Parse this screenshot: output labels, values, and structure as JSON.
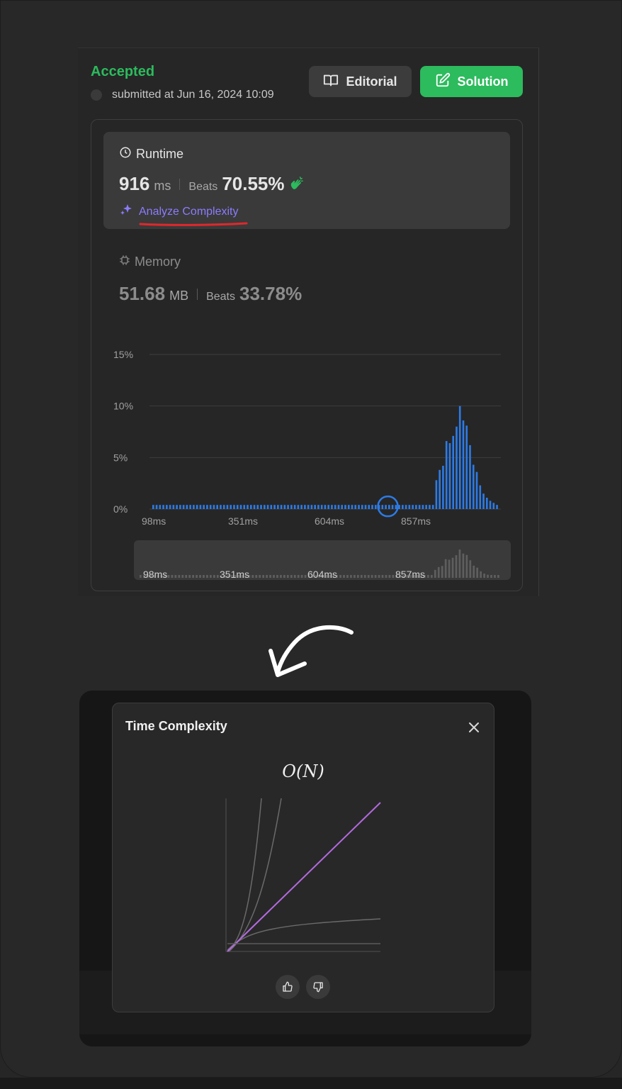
{
  "submission": {
    "status": "Accepted",
    "submitted_text": "submitted at Jun 16, 2024 10:09",
    "editorial_label": "Editorial",
    "solution_label": "Solution",
    "status_color": "#2cbb5d"
  },
  "runtime": {
    "heading": "Runtime",
    "value": "916",
    "unit": "ms",
    "beats_label": "Beats",
    "beats_value": "70.55%",
    "analyze_label": "Analyze Complexity"
  },
  "memory": {
    "heading": "Memory",
    "value": "51.68",
    "unit": "MB",
    "beats_label": "Beats",
    "beats_value": "33.78%"
  },
  "chart_data": {
    "type": "bar",
    "ylabels": [
      "15%",
      "10%",
      "5%",
      "0%"
    ],
    "ylim": [
      0,
      15
    ],
    "xticks": [
      "98ms",
      "351ms",
      "604ms",
      "857ms"
    ],
    "highlight_index": 69,
    "values": [
      0.4,
      0.4,
      0.4,
      0.4,
      0.4,
      0.4,
      0.4,
      0.4,
      0.4,
      0.4,
      0.4,
      0.4,
      0.4,
      0.4,
      0.4,
      0.4,
      0.4,
      0.4,
      0.4,
      0.4,
      0.4,
      0.4,
      0.4,
      0.4,
      0.4,
      0.4,
      0.4,
      0.4,
      0.4,
      0.4,
      0.4,
      0.4,
      0.4,
      0.4,
      0.4,
      0.4,
      0.4,
      0.4,
      0.4,
      0.4,
      0.4,
      0.4,
      0.4,
      0.4,
      0.4,
      0.4,
      0.4,
      0.4,
      0.4,
      0.4,
      0.4,
      0.4,
      0.4,
      0.4,
      0.4,
      0.4,
      0.4,
      0.4,
      0.4,
      0.4,
      0.4,
      0.4,
      0.4,
      0.4,
      0.4,
      0.4,
      0.4,
      0.4,
      0.4,
      0.4,
      0.4,
      0.4,
      0.4,
      0.4,
      0.4,
      0.4,
      0.4,
      0.4,
      0.4,
      0.4,
      0.4,
      0.4,
      0.4,
      0.4,
      2.8,
      3.8,
      4.2,
      6.6,
      6.4,
      7.1,
      8.0,
      10.0,
      8.6,
      8.1,
      6.2,
      4.3,
      3.6,
      2.3,
      1.5,
      1.1,
      0.8,
      0.6,
      0.4
    ],
    "bar_color": "#2d7be5",
    "mini_labels": [
      "98ms",
      "351ms",
      "604ms",
      "857ms"
    ]
  },
  "modal": {
    "title": "Time Complexity",
    "complexity": "O(N)",
    "line_color": "#b46ae0"
  }
}
